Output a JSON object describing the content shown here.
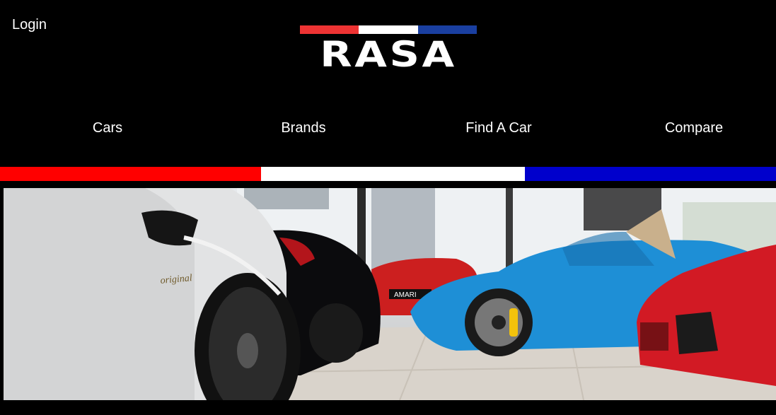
{
  "header": {
    "login_label": "Login",
    "logo_text": "RASA",
    "logo_colors": [
      "#ee3333",
      "#ffffff",
      "#1a3fa0"
    ]
  },
  "nav": {
    "items": [
      {
        "label": "Cars"
      },
      {
        "label": "Brands"
      },
      {
        "label": "Find A Car"
      },
      {
        "label": "Compare"
      }
    ]
  },
  "flag_bar": {
    "colors": [
      "#ff0000",
      "#ffffff",
      "#0000cc"
    ]
  },
  "hero": {
    "plate_text": "AMARI",
    "badge_text": "original"
  }
}
